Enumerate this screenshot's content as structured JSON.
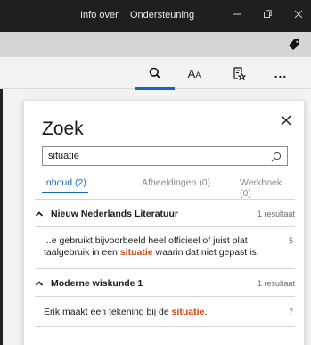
{
  "titlebar": {
    "menu_items": [
      "Info over",
      "Ondersteuning"
    ],
    "window_buttons": [
      "minimize-icon",
      "restore-icon",
      "close-icon"
    ]
  },
  "toolbar": {
    "icons": [
      "search-icon",
      "text-size-icon",
      "bookmark-star-icon",
      "more-icon"
    ],
    "text_size_label": "A",
    "text_size_small": "A",
    "more_label": "..."
  },
  "search_panel": {
    "title": "Zoek",
    "query": "situatie",
    "tabs": [
      {
        "label": "Inhoud (2)",
        "active": true
      },
      {
        "label": "Afbeeldingen (0)",
        "active": false
      },
      {
        "label": "Werkboek (0)",
        "active": false
      }
    ],
    "groups": [
      {
        "title": "Nieuw Nederlands Literatuur",
        "count": "1 resultaat",
        "results": [
          {
            "text_before": "...e gebruikt bijvoorbeeld heel officieel of juist plat taalgebruik in een ",
            "highlight": "situatie",
            "text_after": " waarin dat niet gepast is.",
            "page": "5"
          }
        ]
      },
      {
        "title": "Moderne wiskunde 1",
        "count": "1 resultaat",
        "results": [
          {
            "text_before": "Erik maakt een tekening bij de ",
            "highlight": "situatie",
            "text_after": ".",
            "page": "7"
          }
        ]
      }
    ]
  },
  "colors": {
    "accent": "#1565c0",
    "highlight": "#d2430f",
    "titlebar": "#1f1f1f"
  }
}
